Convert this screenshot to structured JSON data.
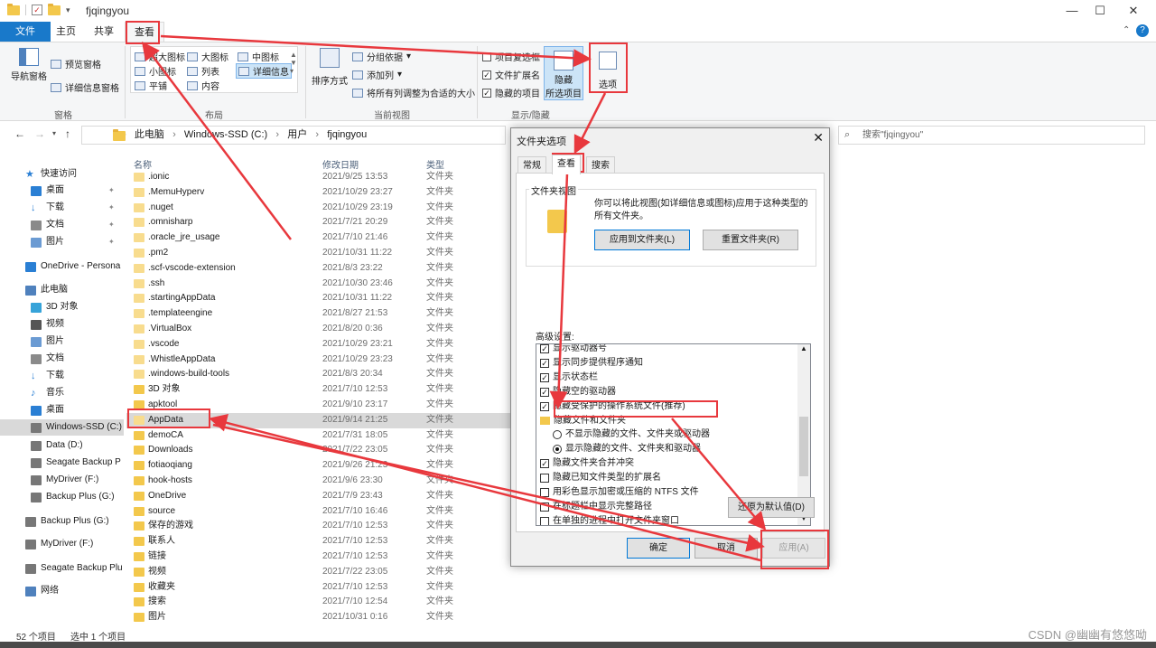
{
  "window": {
    "title": "fjqingyou",
    "controls": {
      "minimize": "—",
      "maximize": "☐",
      "close": "✕"
    },
    "help": "?"
  },
  "ribbon": {
    "tabs": [
      "文件",
      "主页",
      "共享",
      "查看"
    ],
    "active_tab": "查看",
    "groups": {
      "panes": {
        "label": "窗格",
        "nav_pane": "导航窗格",
        "preview_pane": "预览窗格",
        "details_pane": "详细信息窗格"
      },
      "layout": {
        "label": "布局",
        "options": [
          "超大图标",
          "大图标",
          "中图标",
          "小图标",
          "列表",
          "详细信息",
          "平铺",
          "内容"
        ],
        "selected": "详细信息"
      },
      "current_view": {
        "label": "当前视图",
        "sort_by": "排序方式",
        "group_by": "分组依据",
        "add_column": "添加列",
        "fit_columns": "将所有列调整为合适的大小"
      },
      "show_hide": {
        "label": "显示/隐藏",
        "item_checkboxes": "项目复选框",
        "file_extensions": "文件扩展名",
        "hidden_items": "隐藏的项目",
        "hide_selected": [
          "隐藏",
          "所选项目"
        ],
        "options": "选项"
      }
    }
  },
  "address": {
    "path": [
      "此电脑",
      "Windows-SSD (C:)",
      "用户",
      "fjqingyou"
    ],
    "search_placeholder": "搜索\"fjqingyou\""
  },
  "nav_pane": {
    "items": [
      {
        "label": "快速访问",
        "icon": "star-icon",
        "color": "#2a7fd4"
      },
      {
        "label": "桌面",
        "icon": "desktop-icon",
        "color": "#2a7fd4",
        "pinned": true
      },
      {
        "label": "下载",
        "icon": "download-icon",
        "color": "#2a7fd4",
        "pinned": true
      },
      {
        "label": "文档",
        "icon": "document-icon",
        "color": "#8a8a8a",
        "pinned": true
      },
      {
        "label": "图片",
        "icon": "picture-icon",
        "color": "#6b9bd3",
        "pinned": true
      },
      {
        "label": "OneDrive - Persona",
        "icon": "cloud-icon",
        "color": "#2a7fd4"
      },
      {
        "label": "此电脑",
        "icon": "computer-icon",
        "color": "#4f81bd"
      },
      {
        "label": "3D 对象",
        "icon": "cube-icon",
        "color": "#36a3d9"
      },
      {
        "label": "视频",
        "icon": "video-icon",
        "color": "#555555"
      },
      {
        "label": "图片",
        "icon": "picture-icon",
        "color": "#6b9bd3"
      },
      {
        "label": "文档",
        "icon": "document-icon",
        "color": "#8a8a8a"
      },
      {
        "label": "下载",
        "icon": "download-icon",
        "color": "#2a7fd4"
      },
      {
        "label": "音乐",
        "icon": "music-icon",
        "color": "#2a7fd4"
      },
      {
        "label": "桌面",
        "icon": "desktop-icon",
        "color": "#2a7fd4"
      },
      {
        "label": "Windows-SSD (C:)",
        "icon": "drive-icon",
        "color": "#777777",
        "selected": true
      },
      {
        "label": "Data (D:)",
        "icon": "drive-icon",
        "color": "#777777"
      },
      {
        "label": "Seagate Backup P",
        "icon": "drive-icon",
        "color": "#777777"
      },
      {
        "label": "MyDriver (F:)",
        "icon": "drive-icon",
        "color": "#777777"
      },
      {
        "label": "Backup Plus (G:)",
        "icon": "drive-icon",
        "color": "#777777"
      },
      {
        "label": "Backup Plus (G:)",
        "icon": "drive-icon",
        "color": "#777777"
      },
      {
        "label": "MyDriver (F:)",
        "icon": "drive-icon",
        "color": "#777777"
      },
      {
        "label": "Seagate Backup Plu",
        "icon": "drive-icon",
        "color": "#777777"
      },
      {
        "label": "网络",
        "icon": "network-icon",
        "color": "#4f81bd"
      }
    ]
  },
  "file_list": {
    "headers": {
      "name": "名称",
      "date": "修改日期",
      "type": "类型"
    },
    "rows": [
      {
        "name": ".ionic",
        "date": "2021/9/25 13:53",
        "type": "文件夹",
        "dim": true
      },
      {
        "name": ".MemuHyperv",
        "date": "2021/10/29 23:27",
        "type": "文件夹",
        "dim": true
      },
      {
        "name": ".nuget",
        "date": "2021/10/29 23:19",
        "type": "文件夹",
        "dim": true
      },
      {
        "name": ".omnisharp",
        "date": "2021/7/21 20:29",
        "type": "文件夹",
        "dim": true
      },
      {
        "name": ".oracle_jre_usage",
        "date": "2021/7/10 21:46",
        "type": "文件夹",
        "dim": true
      },
      {
        "name": ".pm2",
        "date": "2021/10/31 11:22",
        "type": "文件夹",
        "dim": true
      },
      {
        "name": ".scf-vscode-extension",
        "date": "2021/8/3 23:22",
        "type": "文件夹",
        "dim": true
      },
      {
        "name": ".ssh",
        "date": "2021/10/30 23:46",
        "type": "文件夹",
        "dim": true
      },
      {
        "name": ".startingAppData",
        "date": "2021/10/31 11:22",
        "type": "文件夹",
        "dim": true
      },
      {
        "name": ".templateengine",
        "date": "2021/8/27 21:53",
        "type": "文件夹",
        "dim": true
      },
      {
        "name": ".VirtualBox",
        "date": "2021/8/20 0:36",
        "type": "文件夹",
        "dim": true
      },
      {
        "name": ".vscode",
        "date": "2021/10/29 23:21",
        "type": "文件夹",
        "dim": true
      },
      {
        "name": ".WhistleAppData",
        "date": "2021/10/29 23:23",
        "type": "文件夹",
        "dim": true
      },
      {
        "name": ".windows-build-tools",
        "date": "2021/8/3 20:34",
        "type": "文件夹",
        "dim": true
      },
      {
        "name": "3D 对象",
        "date": "2021/7/10 12:53",
        "type": "文件夹"
      },
      {
        "name": "apktool",
        "date": "2021/9/10 23:17",
        "type": "文件夹"
      },
      {
        "name": "AppData",
        "date": "2021/9/14 21:25",
        "type": "文件夹",
        "selected": true,
        "dim": true
      },
      {
        "name": "demoCA",
        "date": "2021/7/31 18:05",
        "type": "文件夹"
      },
      {
        "name": "Downloads",
        "date": "2021/7/22 23:05",
        "type": "文件夹"
      },
      {
        "name": "fotiaoqiang",
        "date": "2021/9/26 21:23",
        "type": "文件夹"
      },
      {
        "name": "hook-hosts",
        "date": "2021/9/6 23:30",
        "type": "文件夹"
      },
      {
        "name": "OneDrive",
        "date": "2021/7/9 23:43",
        "type": "文件夹"
      },
      {
        "name": "source",
        "date": "2021/7/10 16:46",
        "type": "文件夹"
      },
      {
        "name": "保存的游戏",
        "date": "2021/7/10 12:53",
        "type": "文件夹"
      },
      {
        "name": "联系人",
        "date": "2021/7/10 12:53",
        "type": "文件夹"
      },
      {
        "name": "链接",
        "date": "2021/7/10 12:53",
        "type": "文件夹"
      },
      {
        "name": "视频",
        "date": "2021/7/22 23:05",
        "type": "文件夹"
      },
      {
        "name": "收藏夹",
        "date": "2021/7/10 12:53",
        "type": "文件夹"
      },
      {
        "name": "搜索",
        "date": "2021/7/10 12:54",
        "type": "文件夹"
      },
      {
        "name": "图片",
        "date": "2021/10/31 0:16",
        "type": "文件夹"
      }
    ]
  },
  "status_bar": {
    "count": "52 个项目",
    "selected": "选中 1 个项目"
  },
  "dialog": {
    "title": "文件夹选项",
    "tabs": [
      "常规",
      "查看",
      "搜索"
    ],
    "active_tab": "查看",
    "folder_views": {
      "label": "文件夹视图",
      "description": "你可以将此视图(如详细信息或图标)应用于这种类型的所有文件夹。",
      "apply_button": "应用到文件夹(L)",
      "reset_button": "重置文件夹(R)"
    },
    "advanced": {
      "label": "高级设置:",
      "items": [
        {
          "label": "显示驱动器号",
          "kind": "checkbox",
          "checked": true
        },
        {
          "label": "显示同步提供程序通知",
          "kind": "checkbox",
          "checked": true
        },
        {
          "label": "显示状态栏",
          "kind": "checkbox",
          "checked": true
        },
        {
          "label": "隐藏空的驱动器",
          "kind": "checkbox",
          "checked": true
        },
        {
          "label": "隐藏受保护的操作系统文件(推荐)",
          "kind": "checkbox",
          "checked": true
        },
        {
          "label": "隐藏文件和文件夹",
          "kind": "folder"
        },
        {
          "label": "不显示隐藏的文件、文件夹或驱动器",
          "kind": "radio",
          "checked": false
        },
        {
          "label": "显示隐藏的文件、文件夹和驱动器",
          "kind": "radio",
          "checked": true
        },
        {
          "label": "隐藏文件夹合并冲突",
          "kind": "checkbox",
          "checked": true
        },
        {
          "label": "隐藏已知文件类型的扩展名",
          "kind": "checkbox",
          "checked": false
        },
        {
          "label": "用彩色显示加密或压缩的 NTFS 文件",
          "kind": "checkbox",
          "checked": false
        },
        {
          "label": "在标题栏中显示完整路径",
          "kind": "checkbox",
          "checked": false
        },
        {
          "label": "在单独的进程中打开文件夹窗口",
          "kind": "checkbox",
          "checked": false
        }
      ],
      "restore_button": "还原为默认值(D)"
    },
    "ok": "确定",
    "cancel": "取消",
    "apply": "应用(A)"
  },
  "watermark": "CSDN @幽幽有悠悠呦",
  "colors": {
    "accent": "#1979ca",
    "annotation": "#e8383d",
    "selection": "#d9d9d9",
    "folder": "#f3c84c"
  }
}
